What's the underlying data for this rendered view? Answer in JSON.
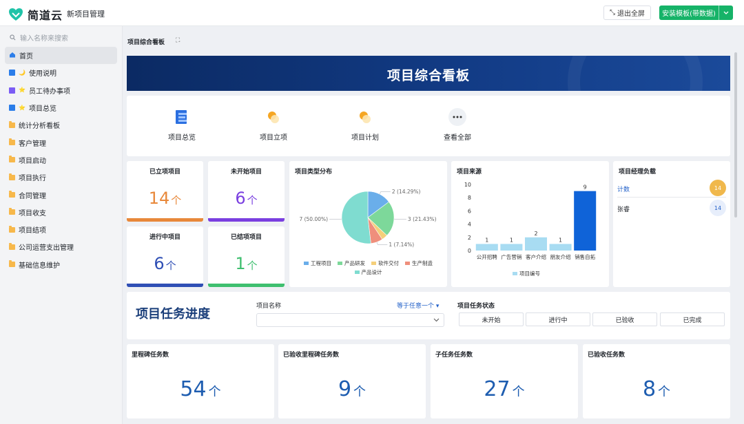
{
  "app": {
    "logo_text": "简道云",
    "title": "新项目管理"
  },
  "toolbar": {
    "fullscreen_label": "退出全屏",
    "install_label": "安装模板(带数据)",
    "accent": "#16b368"
  },
  "sidebar": {
    "search_placeholder": "输入名称来搜索",
    "items": [
      {
        "label": "首页",
        "icon": "home-icon"
      },
      {
        "label": "使用说明",
        "icon": "doc-icon",
        "emoji": "🌙"
      },
      {
        "label": "员工待办事项",
        "icon": "todo-icon",
        "emoji": "⭐"
      },
      {
        "label": "项目总览",
        "icon": "doc-icon",
        "emoji": "⭐"
      },
      {
        "label": "统计分析看板",
        "icon": "folder-icon"
      },
      {
        "label": "客户管理",
        "icon": "folder-icon"
      },
      {
        "label": "项目启动",
        "icon": "folder-icon"
      },
      {
        "label": "项目执行",
        "icon": "folder-icon"
      },
      {
        "label": "合同管理",
        "icon": "folder-icon"
      },
      {
        "label": "项目收支",
        "icon": "folder-icon"
      },
      {
        "label": "项目结项",
        "icon": "folder-icon"
      },
      {
        "label": "公司运营支出管理",
        "icon": "folder-icon"
      },
      {
        "label": "基础信息维护",
        "icon": "folder-icon"
      }
    ]
  },
  "page": {
    "breadcrumb": "项目综合看板",
    "banner_title": "项目综合看板"
  },
  "quick_links": [
    "项目总览",
    "项目立项",
    "项目计划",
    "查看全部"
  ],
  "summary_cards": [
    {
      "title": "已立项项目",
      "value": "14",
      "unit": "个",
      "color": "#e8883a"
    },
    {
      "title": "未开始项目",
      "value": "6",
      "unit": "个",
      "color": "#7a3fe0"
    },
    {
      "title": "进行中项目",
      "value": "6",
      "unit": "个",
      "color": "#2f4fb5"
    },
    {
      "title": "已结项项目",
      "value": "1",
      "unit": "个",
      "color": "#3fbf6f"
    }
  ],
  "pie_panel": {
    "title": "项目类型分布"
  },
  "bar_panel": {
    "title": "项目来源"
  },
  "manager_panel": {
    "title": "项目经理负载",
    "rows": [
      {
        "name": "计数",
        "value": "14"
      },
      {
        "name": "张睿",
        "value": "14"
      }
    ]
  },
  "task_section": {
    "title": "项目任务进度",
    "project_label": "项目名称",
    "filter_link": "等于任意一个",
    "status_label": "项目任务状态",
    "statuses": [
      "未开始",
      "进行中",
      "已验收",
      "已完成"
    ]
  },
  "stat_cards": [
    {
      "title": "里程碑任务数",
      "value": "54",
      "unit": "个"
    },
    {
      "title": "已验收里程碑任务数",
      "value": "9",
      "unit": "个"
    },
    {
      "title": "子任务任务数",
      "value": "27",
      "unit": "个"
    },
    {
      "title": "已验收任务数",
      "value": "8",
      "unit": "个"
    }
  ],
  "chart_data": [
    {
      "type": "pie",
      "categories": [
        "工程项目",
        "产品研发",
        "软件交付",
        "生产制造",
        "产品设计"
      ],
      "values": [
        2,
        3,
        0.5,
        1,
        7
      ],
      "slice_labels": [
        "2 (14.29%)",
        "3 (21.43%)",
        "",
        "1 (7.14%)",
        "7 (50.00%)"
      ],
      "colors": [
        "#6aaeea",
        "#7dd89a",
        "#f5cf7a",
        "#ef8f7c",
        "#7fdcd0"
      ]
    },
    {
      "type": "bar",
      "categories": [
        "公开招聘",
        "广告营销",
        "客户介绍",
        "朋友介绍",
        "销售自拓"
      ],
      "values": [
        1,
        1,
        2,
        1,
        9
      ],
      "series_name": "项目编号",
      "ylim": [
        0,
        10
      ],
      "yticks": [
        0,
        2,
        4,
        6,
        8,
        10
      ],
      "colors": {
        "bar": "#a8dcf2",
        "highlight": "#0f63d8"
      }
    }
  ]
}
